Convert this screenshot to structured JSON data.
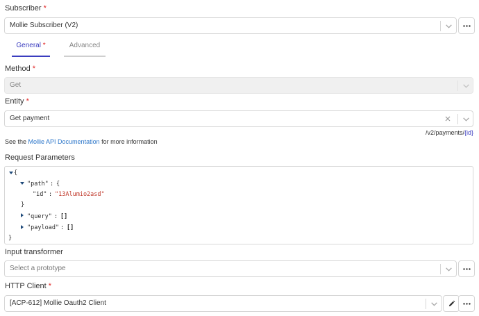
{
  "subscriber": {
    "label": "Subscriber",
    "required_mark": "*",
    "value": "Mollie Subscriber (V2)"
  },
  "tabs": [
    {
      "label": "General",
      "required_mark": "*",
      "active": true
    },
    {
      "label": "Advanced",
      "active": false
    }
  ],
  "method": {
    "label": "Method",
    "required_mark": "*",
    "value": "Get"
  },
  "entity": {
    "label": "Entity",
    "required_mark": "*",
    "value": "Get payment",
    "endpoint_path": "/v2/payments/",
    "endpoint_param": "{id}"
  },
  "docs_hint": {
    "prefix": "See the ",
    "link": "Mollie API Documentation",
    "suffix": " for more information"
  },
  "request_parameters": {
    "label": "Request Parameters",
    "lines": {
      "open": "{",
      "path_key": "\"path\"",
      "colon_path": ":",
      "path_open": "{",
      "id_key": "\"id\"",
      "colon_id": ":",
      "id_value": "\"13Alumio2asd\"",
      "path_close": "}",
      "query_key": "\"query\"",
      "colon_query": ":",
      "query_value": "[]",
      "payload_key": "\"payload\"",
      "colon_payload": ":",
      "payload_value": "[]",
      "close": "}"
    }
  },
  "input_transformer": {
    "label": "Input transformer",
    "placeholder": "Select a prototype"
  },
  "http_client": {
    "label": "HTTP Client",
    "required_mark": "*",
    "value": "[ACP-612] Mollie Oauth2 Client"
  },
  "colors": {
    "accent": "#3b3dbf",
    "required": "#e02424",
    "link": "#2a75c9",
    "string": "#c0392b"
  }
}
